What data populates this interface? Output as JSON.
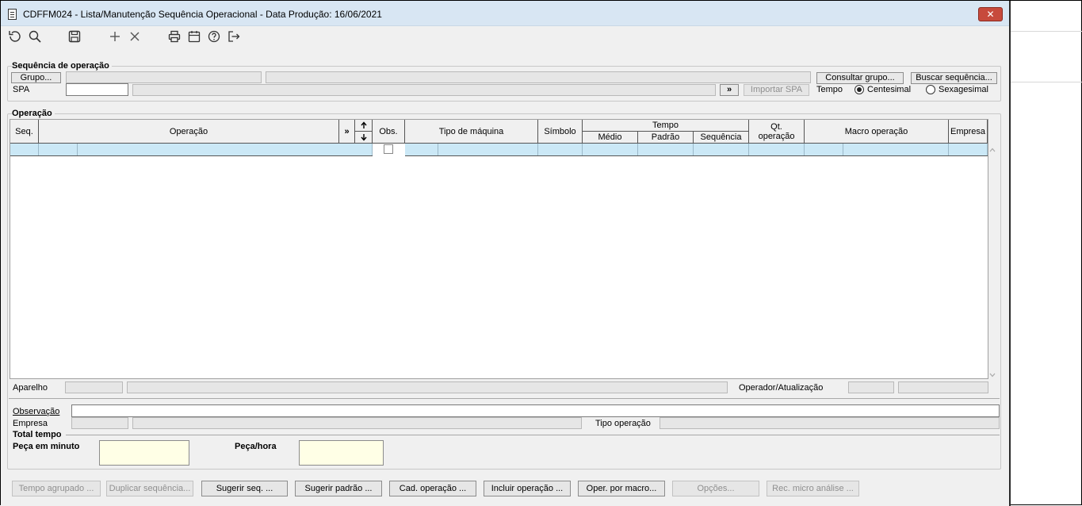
{
  "window": {
    "title": "CDFFM024 - Lista/Manutenção Sequência Operacional - Data Produção: 16/06/2021",
    "close_glyph": "✕"
  },
  "toolbar": {
    "icons": [
      "undo-icon",
      "search-icon",
      "save-icon",
      "add-icon",
      "delete-icon",
      "print-icon",
      "calendar-icon",
      "help-icon",
      "exit-icon"
    ]
  },
  "sequencia": {
    "group_label": "Sequência de operação",
    "grupo_button": "Grupo...",
    "spa_label": "SPA",
    "spa_value": "",
    "arrow_button": "»",
    "importar_button": "Importar SPA",
    "consultar_button": "Consultar grupo...",
    "buscar_button": "Buscar sequência...",
    "tempo_label": "Tempo",
    "radio_centesimal": "Centesimal",
    "radio_sexagesimal": "Sexagesimal",
    "selected_radio": "Centesimal"
  },
  "operacao": {
    "group_label": "Operação",
    "headers": {
      "seq": "Seq.",
      "operacao": "Operação",
      "expand": "»",
      "obs": "Obs.",
      "tipo_maquina": "Tipo de máquina",
      "simbolo": "Símbolo",
      "tempo": "Tempo",
      "medio": "Médio",
      "padrao": "Padrão",
      "sequencia": "Sequência",
      "qt_operacao": "Qt. operação",
      "macro_operacao": "Macro operação",
      "empresa": "Empresa"
    },
    "aparelho_label": "Aparelho",
    "operador_label": "Operador/Atualização"
  },
  "details": {
    "observacao_label": "Observação",
    "empresa_label": "Empresa",
    "tipo_operacao_label": "Tipo operação",
    "total_tempo_label": "Total tempo",
    "peca_minuto_label": "Peça em minuto",
    "peca_hora_label": "Peça/hora"
  },
  "buttons": [
    {
      "label": "Tempo agrupado ...",
      "enabled": false
    },
    {
      "label": "Duplicar sequência...",
      "enabled": false
    },
    {
      "label": "Sugerir seq. ...",
      "enabled": true
    },
    {
      "label": "Sugerir padrão ...",
      "enabled": true
    },
    {
      "label": "Cad. operação ...",
      "enabled": true
    },
    {
      "label": "Incluir operação ...",
      "enabled": true
    },
    {
      "label": "Oper. por macro...",
      "enabled": true
    },
    {
      "label": "Opções...",
      "enabled": false
    },
    {
      "label": "Rec. micro análise ...",
      "enabled": false
    }
  ]
}
